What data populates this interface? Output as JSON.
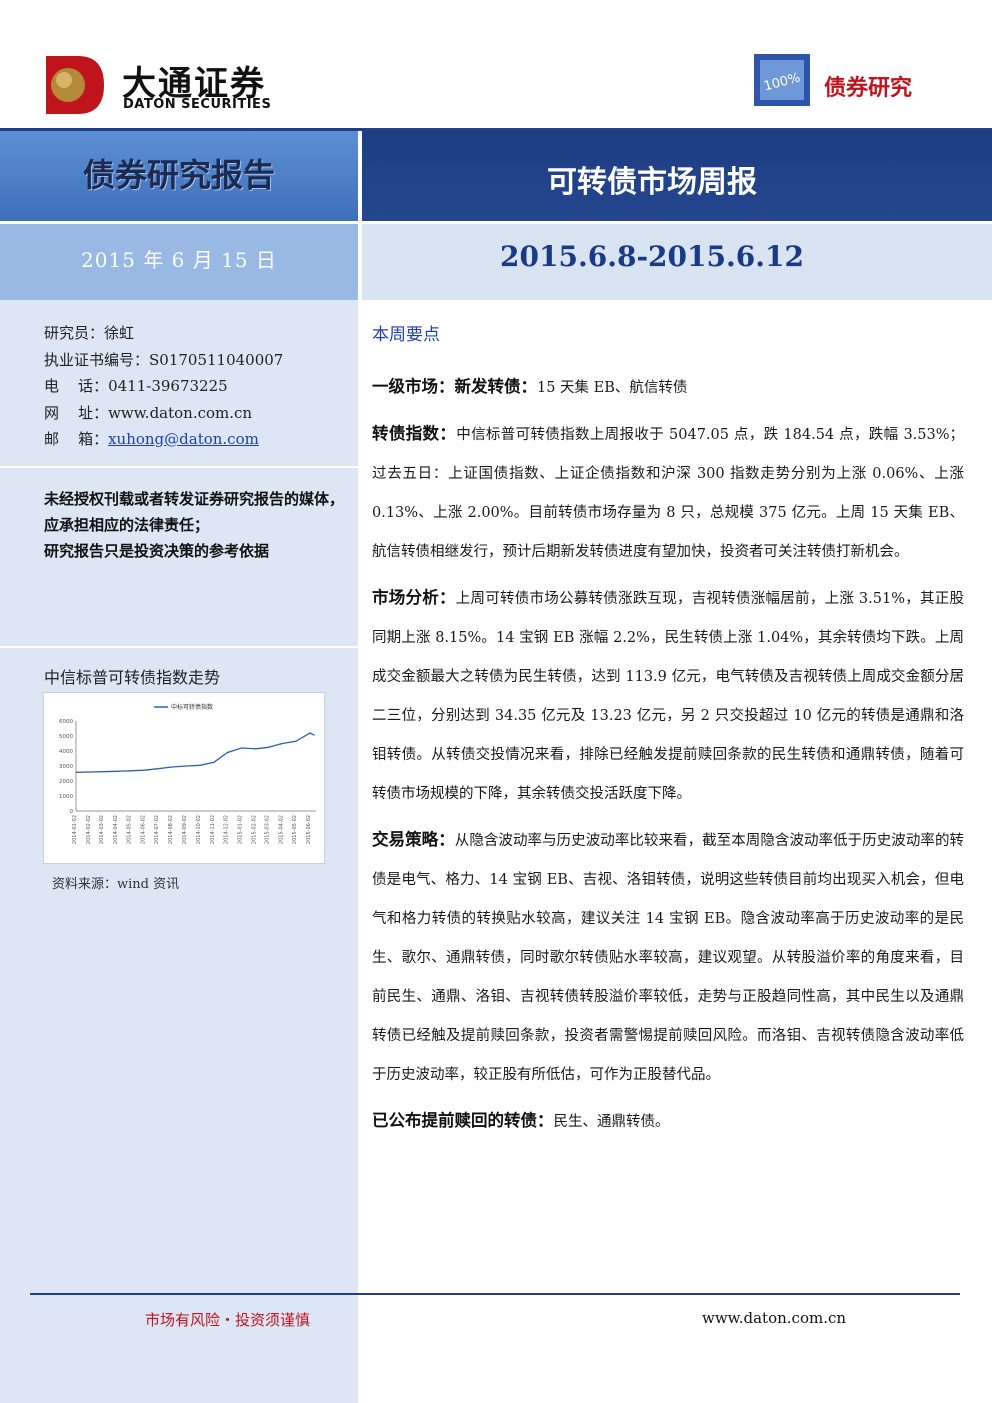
{
  "brand": {
    "name_cn": "大通证券",
    "name_en": "DATON SECURITIES",
    "badge_text": "100%",
    "badge_label": "债券研究"
  },
  "title": {
    "report_type": "债券研究报告",
    "report_name": "可转债市场周报",
    "date": "2015 年 6 月 15 日",
    "period": "2015.6.8-2015.6.12"
  },
  "contact": {
    "analyst": "研究员：徐虹",
    "cert": "执业证书编号：S0170511040007",
    "phone": "电    话：0411-39673225",
    "website": "网    址：www.daton.com.cn",
    "email_label": "邮    箱：",
    "email": "xuhong@daton.com"
  },
  "legal": {
    "line1": "未经授权刊载或者转发证券研究报告的媒体，应承担相应的法律责任；",
    "line2": "研究报告只是投资决策的参考依据"
  },
  "chart": {
    "title": "中信标普可转债指数走势",
    "source": "资料来源：wind 资讯"
  },
  "chart_data": {
    "type": "line",
    "series": [
      {
        "name": "中标可转债指数",
        "x": [
          "2014-01-02",
          "2014-02-02",
          "2014-03-02",
          "2014-04-02",
          "2014-05-02",
          "2014-06-02",
          "2014-07-02",
          "2014-08-02",
          "2014-09-02",
          "2014-10-02",
          "2014-11-02",
          "2014-12-02",
          "2015-01-02",
          "2015-02-02",
          "2015-03-02",
          "2015-04-02",
          "2015-05-02",
          "2015-06-02",
          "2015-06-12"
        ],
        "values": [
          2580,
          2600,
          2620,
          2650,
          2680,
          2720,
          2820,
          2930,
          3000,
          3050,
          3250,
          3900,
          4200,
          4150,
          4250,
          4500,
          4650,
          5200,
          5047
        ]
      }
    ],
    "x_ticks": [
      "2014-01-02",
      "2014-02-02",
      "2014-03-02",
      "2014-04-02",
      "2014-05-02",
      "2014-06-02",
      "2014-07-02",
      "2014-08-02",
      "2014-09-02",
      "2014-10-02",
      "2014-11-02",
      "2014-12-02",
      "2015-01-02",
      "2015-02-02",
      "2015-03-02",
      "2015-04-02",
      "2015-05-02",
      "2015-06-02"
    ],
    "y_ticks": [
      0,
      1000,
      2000,
      3000,
      4000,
      5000,
      6000
    ],
    "ylim": [
      0,
      6000
    ],
    "legend": "top-center",
    "colors": {
      "line": "#2e5fb5"
    }
  },
  "main": {
    "section_title": "本周要点",
    "paragraphs": [
      {
        "kw": "一级市场：新发转债：",
        "text": "15 天集 EB、航信转债"
      },
      {
        "kw": "转债指数：",
        "text": "中信标普可转债指数上周报收于 5047.05 点，跌 184.54 点，跌幅 3.53%；过去五日：上证国债指数、上证企债指数和沪深 300 指数走势分别为上涨 0.06%、上涨 0.13%、上涨 2.00%。目前转债市场存量为 8 只，总规模 375 亿元。上周 15 天集 EB、航信转债相继发行，预计后期新发转债进度有望加快，投资者可关注转债打新机会。"
      },
      {
        "kw": "市场分析：",
        "text": "上周可转债市场公募转债涨跌互现，吉视转债涨幅居前，上涨 3.51%，其正股同期上涨 8.15%。14 宝钢 EB 涨幅 2.2%，民生转债上涨 1.04%，其余转债均下跌。上周成交金额最大之转债为民生转债，达到 113.9 亿元，电气转债及吉视转债上周成交金额分居二三位，分别达到 34.35 亿元及 13.23 亿元，另 2 只交投超过 10 亿元的转债是通鼎和洛钼转债。从转债交投情况来看，排除已经触发提前赎回条款的民生转债和通鼎转债，随着可转债市场规模的下降，其余转债交投活跃度下降。"
      },
      {
        "kw": "交易策略：",
        "text": "从隐含波动率与历史波动率比较来看，截至本周隐含波动率低于历史波动率的转债是电气、格力、14 宝钢 EB、吉视、洛钼转债，说明这些转债目前均出现买入机会，但电气和格力转债的转换贴水较高，建议关注 14 宝钢 EB。隐含波动率高于历史波动率的是民生、歌尔、通鼎转债，同时歌尔转债贴水率较高，建议观望。从转股溢价率的角度来看，目前民生、通鼎、洛钼、吉视转债转股溢价率较低，走势与正股趋同性高，其中民生以及通鼎转债已经触及提前赎回条款，投资者需警惕提前赎回风险。而洛钼、吉视转债隐含波动率低于历史波动率，较正股有所低估，可作为正股替代品。"
      },
      {
        "kw": "已公布提前赎回的转债：",
        "text": "民生、通鼎转债。"
      }
    ]
  },
  "footer": {
    "risk": "市场有风险・投资须谨慎",
    "url": "www.daton.com.cn"
  }
}
